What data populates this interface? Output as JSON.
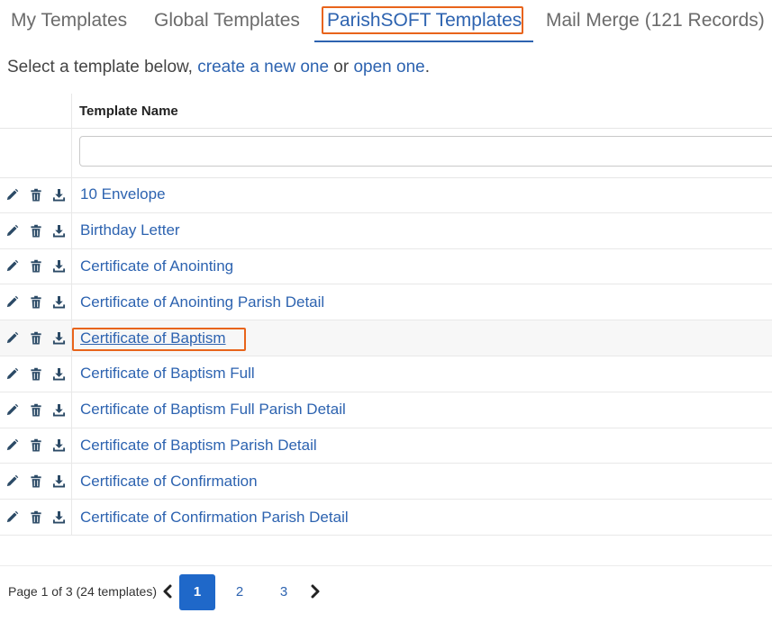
{
  "tabs": [
    {
      "label": "My Templates"
    },
    {
      "label": "Global Templates"
    },
    {
      "label": "ParishSOFT Templates"
    },
    {
      "label": "Mail Merge (121 Records)"
    }
  ],
  "intro": {
    "prefix": "Select a template below, ",
    "create_link": "create a new one",
    "middle": " or ",
    "open_link": "open one",
    "suffix": "."
  },
  "table": {
    "column_header": "Template Name",
    "filter_value": "",
    "rows": [
      {
        "name": "10 Envelope"
      },
      {
        "name": "Birthday Letter"
      },
      {
        "name": "Certificate of Anointing"
      },
      {
        "name": "Certificate of Anointing Parish Detail"
      },
      {
        "name": "Certificate of Baptism"
      },
      {
        "name": "Certificate of Baptism Full"
      },
      {
        "name": "Certificate of Baptism Full Parish Detail"
      },
      {
        "name": "Certificate of Baptism Parish Detail"
      },
      {
        "name": "Certificate of Confirmation"
      },
      {
        "name": "Certificate of Confirmation Parish Detail"
      }
    ],
    "row_icons": [
      "pencil-icon",
      "trash-icon",
      "download-icon"
    ]
  },
  "pager": {
    "summary": "Page 1 of 3 (24 templates)",
    "pages": [
      "1",
      "2",
      "3"
    ],
    "current": "1"
  },
  "colors": {
    "link": "#2d63b0",
    "highlight_box": "#e8641b",
    "active_page": "#1f68c9",
    "icon": "#2b4a66"
  }
}
